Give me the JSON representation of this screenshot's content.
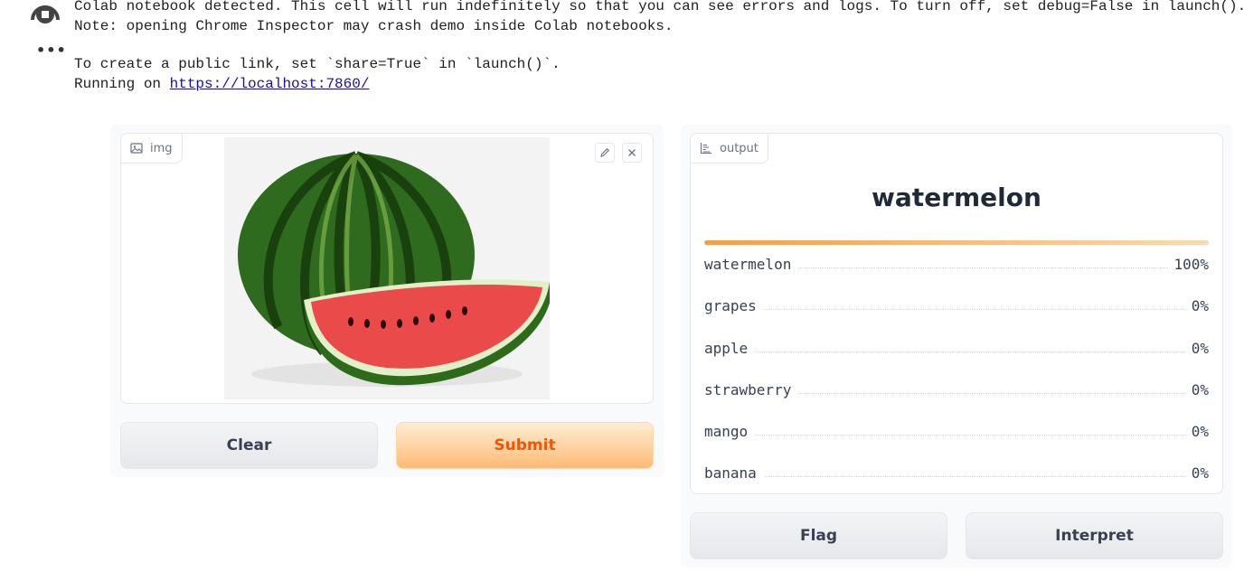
{
  "console": {
    "line1": "Colab notebook detected. This cell will run indefinitely so that you can see errors and logs. To turn off, set debug=False in launch().",
    "line2": "Note: opening Chrome Inspector may crash demo inside Colab notebooks.",
    "line3": "To create a public link, set `share=True` in `launch()`.",
    "line4_prefix": "Running on ",
    "link": "https://localhost:7860/"
  },
  "input": {
    "label": "img",
    "clear_label": "Clear",
    "submit_label": "Submit"
  },
  "output": {
    "label": "output",
    "prediction": "watermelon",
    "confidences": [
      {
        "label": "watermelon",
        "value": "100%"
      },
      {
        "label": "grapes",
        "value": "0%"
      },
      {
        "label": "apple",
        "value": "0%"
      },
      {
        "label": "strawberry",
        "value": "0%"
      },
      {
        "label": "mango",
        "value": "0%"
      },
      {
        "label": "banana",
        "value": "0%"
      }
    ],
    "flag_label": "Flag",
    "interpret_label": "Interpret"
  },
  "colors": {
    "accent": "#ea580c",
    "bar_start": "#f59e42",
    "bar_end": "#fcd9b0"
  },
  "icons": [
    "stop-run-icon",
    "more-icon",
    "image-icon",
    "edit-icon",
    "close-icon",
    "chart-icon"
  ]
}
